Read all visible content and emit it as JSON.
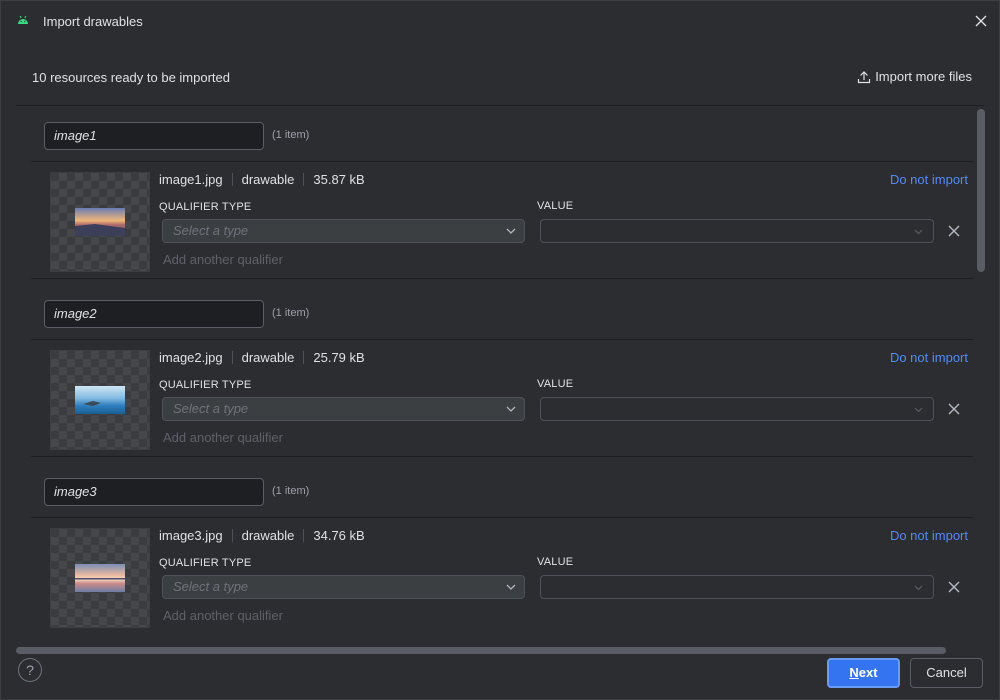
{
  "window": {
    "title": "Import drawables"
  },
  "header": {
    "summary": "10 resources ready to be imported",
    "import_more_label": "Import more files"
  },
  "groups": [
    {
      "name": "image1",
      "count": "(1 item)",
      "file": "image1.jpg",
      "type": "drawable",
      "size": "35.87 kB",
      "do_not_import": "Do not import",
      "qualifier_type_label": "QUALIFIER TYPE",
      "value_label": "VALUE",
      "select_placeholder": "Select a type",
      "value": "",
      "add_qualifier": "Add another qualifier"
    },
    {
      "name": "image2",
      "count": "(1 item)",
      "file": "image2.jpg",
      "type": "drawable",
      "size": "25.79 kB",
      "do_not_import": "Do not import",
      "qualifier_type_label": "QUALIFIER TYPE",
      "value_label": "VALUE",
      "select_placeholder": "Select a type",
      "value": "",
      "add_qualifier": "Add another qualifier"
    },
    {
      "name": "image3",
      "count": "(1 item)",
      "file": "image3.jpg",
      "type": "drawable",
      "size": "34.76 kB",
      "do_not_import": "Do not import",
      "qualifier_type_label": "QUALIFIER TYPE",
      "value_label": "VALUE",
      "select_placeholder": "Select a type",
      "value": "",
      "add_qualifier": "Add another qualifier"
    }
  ],
  "footer": {
    "help": "?",
    "next_mnemonic": "N",
    "next_rest": "ext",
    "cancel": "Cancel"
  },
  "icons": {
    "app": "android-icon",
    "close": "close-icon",
    "upload": "upload-icon",
    "chevron": "chevron-down-icon",
    "remove": "remove-qualifier-icon"
  },
  "colors": {
    "accent": "#3574f0",
    "link": "#548af7",
    "android": "#3ddc84",
    "background": "#2b2d30"
  }
}
